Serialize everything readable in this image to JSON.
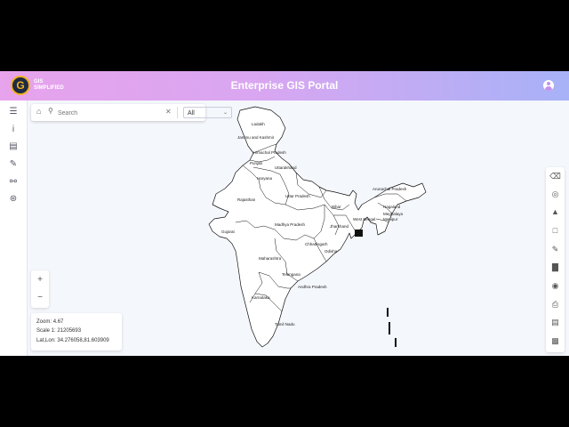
{
  "header": {
    "brand_line1": "GIS",
    "brand_line2": "SIMPLIFIED",
    "logo_letter": "G",
    "title": "Enterprise GIS Portal"
  },
  "search": {
    "placeholder": "Search",
    "filter_value": "All"
  },
  "left_tools": [
    "layers-icon",
    "info-icon",
    "database-icon",
    "edit-pencil-icon",
    "share-nodes-icon",
    "network-icon"
  ],
  "zoom_controls": {
    "plus": "+",
    "minus": "−"
  },
  "status": {
    "zoom_label": "Zoom:",
    "zoom_value": "4.67",
    "scale_label": "Scale 1:",
    "scale_value": "21205693",
    "latlon_label": "Lat,Lon:",
    "latlon_value": "34.276058,81.603909"
  },
  "right_tools": [
    "eraser-icon",
    "locate-icon",
    "terrain-icon",
    "select-box-icon",
    "edit-note-icon",
    "chart-icon",
    "camera-icon",
    "print-icon",
    "legend-icon",
    "toolbox-icon"
  ],
  "map_labels": [
    "Ladakh",
    "Jammu and Kashmir",
    "Himachal Pradesh",
    "Punjab",
    "Uttarakhand",
    "Haryana",
    "Uttar Pradesh",
    "Rajasthan",
    "Bihar",
    "Arunachal Pradesh",
    "Nagaland",
    "Meghalaya",
    "Manipur",
    "Jharkhand",
    "Gujarat",
    "Madhya Pradesh",
    "West Bengal",
    "Chhattisgarh",
    "Odisha",
    "Maharashtra",
    "Telangana",
    "Andhra Pradesh",
    "Karnataka",
    "Tamil Nadu"
  ],
  "colors": {
    "header_start": "#e7a3ec",
    "header_end": "#a7b2f7",
    "map_background": "#f4f7fb"
  }
}
